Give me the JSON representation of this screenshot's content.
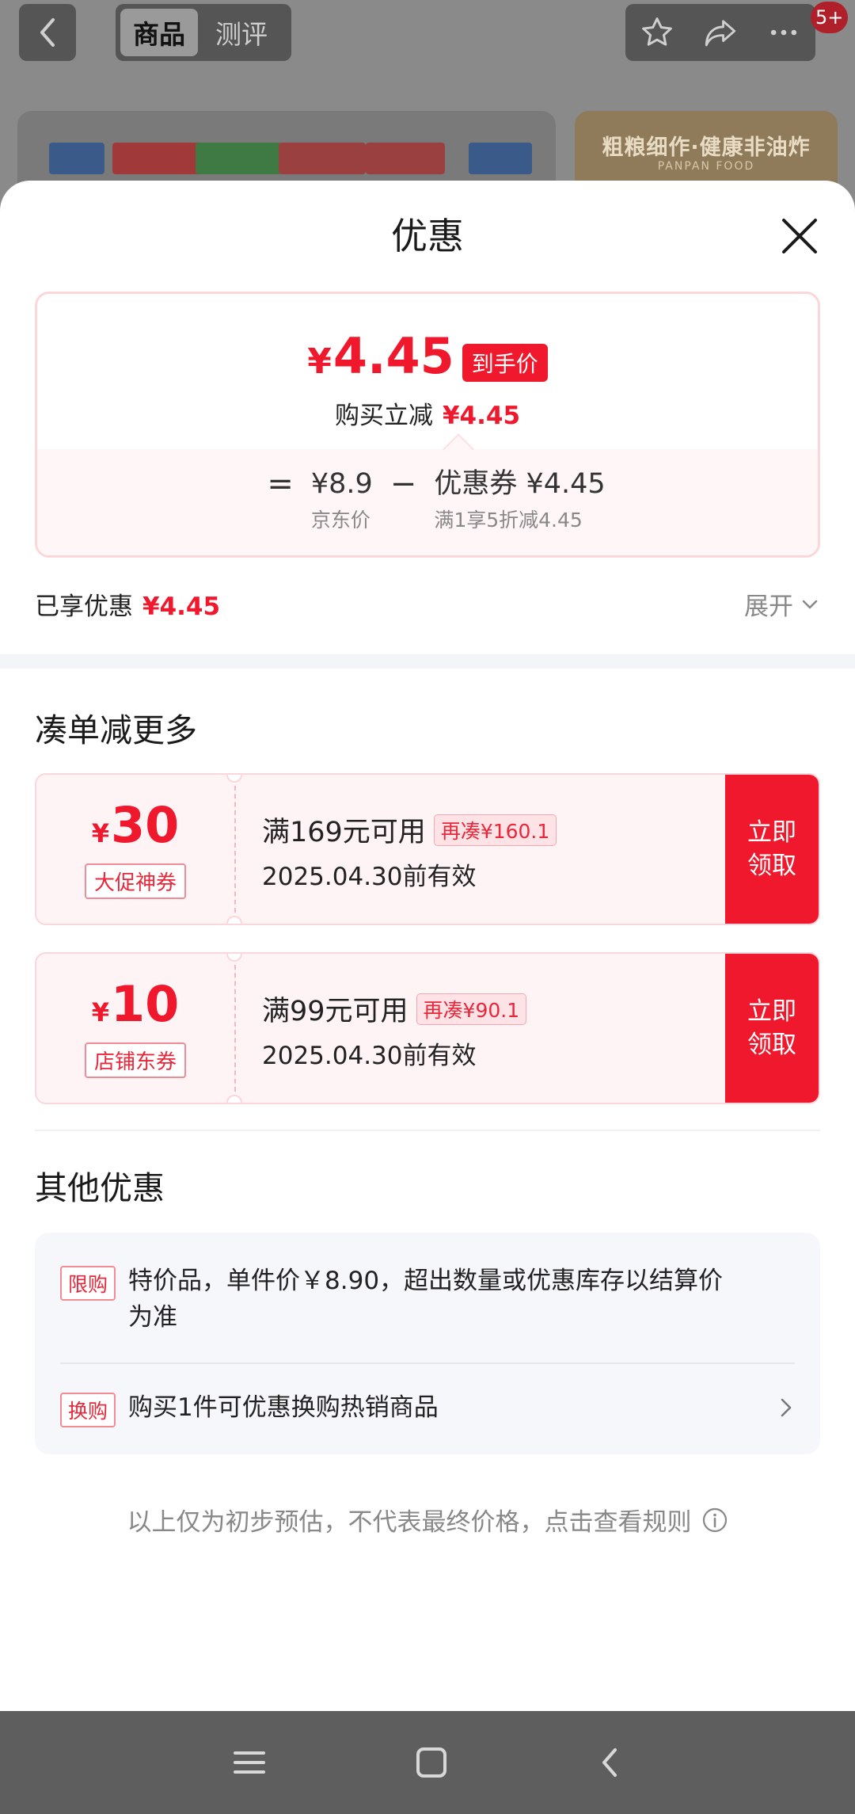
{
  "topbar": {
    "tab_products": "商品",
    "tab_reviews": "测评",
    "badge": "5+"
  },
  "banner": {
    "title": "粗粮细作·健康非油炸",
    "subtitle": "PANPAN FOOD"
  },
  "sheet": {
    "title": "优惠"
  },
  "summary": {
    "final_price_symbol": "¥",
    "final_price": "4.45",
    "final_tag": "到手价",
    "instant_label": "购买立减",
    "instant_amount": "¥4.45",
    "eq": "=",
    "minus": "−",
    "jd_price": "¥8.9",
    "jd_label": "京东价",
    "coupon_value": "优惠券 ¥4.45",
    "coupon_rule": "满1享5折减4.45"
  },
  "enjoyed": {
    "label": "已享优惠",
    "amount": "¥4.45",
    "expand": "展开"
  },
  "more_section": {
    "title": "凑单减更多"
  },
  "coupons": [
    {
      "yen": "¥",
      "amount": "30",
      "tag": "大促神券",
      "condition": "满169元可用",
      "extra": "再凑¥160.1",
      "validity": "2025.04.30前有效",
      "claim_line1": "立即",
      "claim_line2": "领取"
    },
    {
      "yen": "¥",
      "amount": "10",
      "tag": "店铺东券",
      "condition": "满99元可用",
      "extra": "再凑¥90.1",
      "validity": "2025.04.30前有效",
      "claim_line1": "立即",
      "claim_line2": "领取"
    }
  ],
  "other_section": {
    "title": "其他优惠",
    "items": [
      {
        "tag": "限购",
        "text": "特价品，单件价￥8.90，超出数量或优惠库存以结算价为准"
      },
      {
        "tag": "换购",
        "text": "购买1件可优惠换购热销商品"
      }
    ]
  },
  "disclaimer": "以上仅为初步预估，不代表最终价格，点击查看规则",
  "colors": {
    "accent_red": "#f0182c",
    "tag_border": "#f28b96",
    "muted_text": "#888888"
  }
}
